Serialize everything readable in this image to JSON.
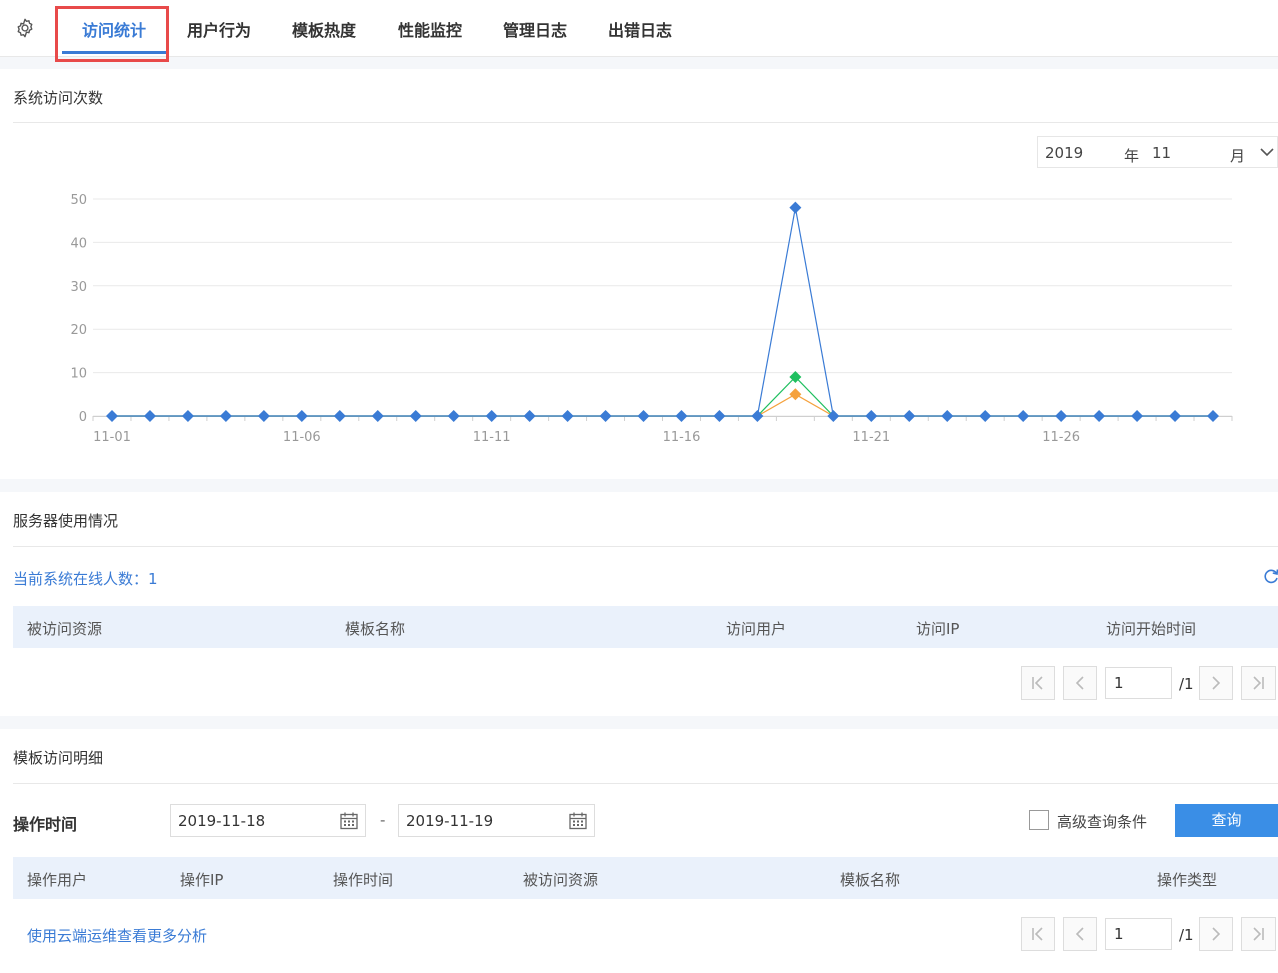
{
  "tabs": [
    {
      "label": "访问统计",
      "active": true
    },
    {
      "label": "用户行为"
    },
    {
      "label": "模板热度"
    },
    {
      "label": "性能监控"
    },
    {
      "label": "管理日志"
    },
    {
      "label": "出错日志"
    }
  ],
  "icons": {
    "settings": "gear-icon",
    "dropdown": "chevron-down-icon",
    "refresh": "refresh-icon",
    "calendar": "calendar-icon",
    "first": "first-page-icon",
    "prev": "prev-page-icon",
    "next": "next-page-icon",
    "last": "last-page-icon"
  },
  "colors": {
    "accent": "#3a7bd5",
    "highlight_border": "#e84a4a",
    "series_blue": "#3a7bd5",
    "series_green": "#1fbf5f",
    "series_orange": "#f5a13c",
    "header_bg": "#eaf1fb",
    "button_bg": "#3a8ee6"
  },
  "visit_section": {
    "title": "系统访问次数",
    "month_picker": {
      "year": "2019",
      "year_unit": "年",
      "month": "11",
      "month_unit": "月"
    }
  },
  "chart_data": {
    "type": "line",
    "x": [
      "11-01",
      "11-02",
      "11-03",
      "11-04",
      "11-05",
      "11-06",
      "11-07",
      "11-08",
      "11-09",
      "11-10",
      "11-11",
      "11-12",
      "11-13",
      "11-14",
      "11-15",
      "11-16",
      "11-17",
      "11-18",
      "11-19",
      "11-20",
      "11-21",
      "11-22",
      "11-23",
      "11-24",
      "11-25",
      "11-26",
      "11-27",
      "11-28",
      "11-29",
      "11-30"
    ],
    "x_tick_labels": [
      "11-01",
      "11-06",
      "11-11",
      "11-16",
      "11-21",
      "11-26"
    ],
    "y_ticks": [
      0,
      10,
      20,
      30,
      40,
      50
    ],
    "ylim": [
      0,
      50
    ],
    "grid": true,
    "series": [
      {
        "color": "#3a7bd5",
        "marker": "diamond",
        "values": [
          0,
          0,
          0,
          0,
          0,
          0,
          0,
          0,
          0,
          0,
          0,
          0,
          0,
          0,
          0,
          0,
          0,
          0,
          48,
          0,
          0,
          0,
          0,
          0,
          0,
          0,
          0,
          0,
          0,
          0
        ]
      },
      {
        "color": "#1fbf5f",
        "marker": "diamond",
        "values": [
          0,
          0,
          0,
          0,
          0,
          0,
          0,
          0,
          0,
          0,
          0,
          0,
          0,
          0,
          0,
          0,
          0,
          0,
          9,
          0,
          0,
          0,
          0,
          0,
          0,
          0,
          0,
          0,
          0,
          0
        ]
      },
      {
        "color": "#f5a13c",
        "marker": "diamond",
        "values": [
          0,
          0,
          0,
          0,
          0,
          0,
          0,
          0,
          0,
          0,
          0,
          0,
          0,
          0,
          0,
          0,
          0,
          0,
          5,
          0,
          0,
          0,
          0,
          0,
          0,
          0,
          0,
          0,
          0,
          0
        ]
      }
    ]
  },
  "server_section": {
    "title": "服务器使用情况",
    "online_label": "当前系统在线人数：",
    "online_count": "1",
    "columns": [
      "被访问资源",
      "模板名称",
      "访问用户",
      "访问IP",
      "访问开始时间"
    ],
    "rows": [],
    "pager": {
      "page": "1",
      "total": "/1"
    }
  },
  "template_section": {
    "title": "模板访问明细",
    "filter_label": "操作时间",
    "start_date": "2019-11-18",
    "end_date": "2019-11-19",
    "separator": "-",
    "advanced_label": "高级查询条件",
    "query_label": "查询",
    "columns": [
      "操作用户",
      "操作IP",
      "操作时间",
      "被访问资源",
      "模板名称",
      "操作类型"
    ],
    "rows": [],
    "link_label": "使用云端运维查看更多分析",
    "pager": {
      "page": "1",
      "total": "/1"
    }
  }
}
